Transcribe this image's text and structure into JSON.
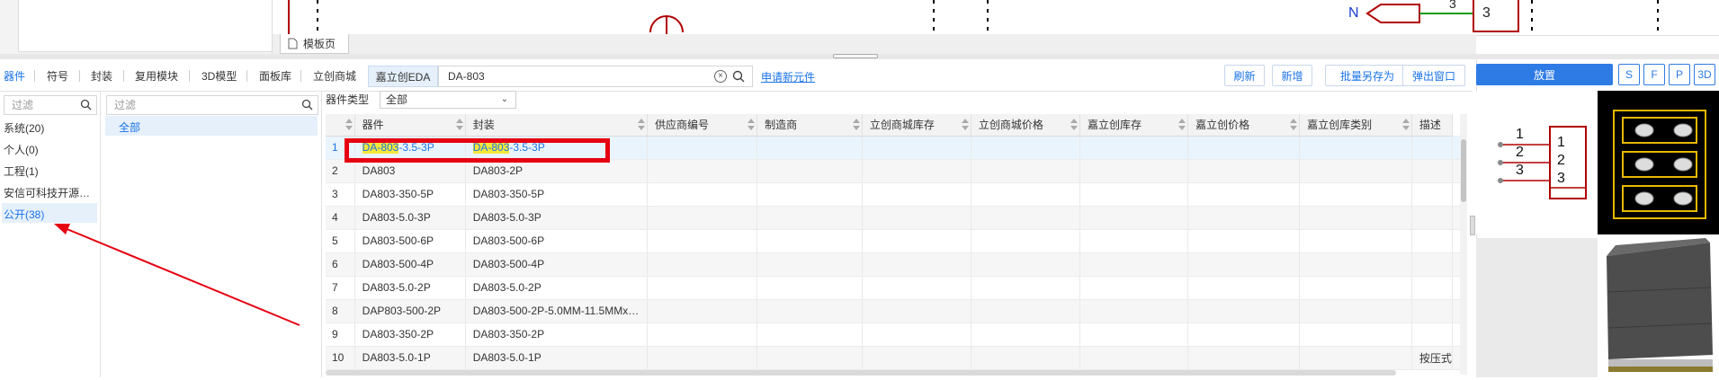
{
  "doc_tab": {
    "label": "模板页"
  },
  "canvas": {
    "net_labels": [
      "N",
      "3",
      "3"
    ]
  },
  "nav": {
    "items": [
      "器件",
      "符号",
      "封装",
      "复用模块",
      "3D模型",
      "面板库",
      "立创商城",
      "嘉立创EDA"
    ],
    "active": "器件"
  },
  "search": {
    "value": "DA-803",
    "apply_link": "申请新元件"
  },
  "buttons": {
    "refresh": "刷新",
    "add": "新增",
    "batch_save": "批量另存为",
    "popup": "弹出窗口"
  },
  "left_panel": {
    "filter_placeholder": "过滤",
    "libraries": [
      "系统(20)",
      "个人(0)",
      "工程(1)",
      "安信可科技开源…",
      "公开(38)"
    ],
    "selected": "公开(38)"
  },
  "mid_panel": {
    "filter_placeholder": "过滤",
    "items": [
      "全部"
    ]
  },
  "type_filter": {
    "label": "器件类型",
    "value": "全部"
  },
  "table": {
    "headers": [
      "器件",
      "封装",
      "供应商编号",
      "制造商",
      "立创商城库存",
      "立创商城价格",
      "嘉立创库存",
      "嘉立创价格",
      "嘉立创库类别",
      "描述"
    ],
    "rows": [
      {
        "idx": "1",
        "part": "DA-803-3.5-3P",
        "pkg": "DA-803-3.5-3P",
        "desc": ""
      },
      {
        "idx": "2",
        "part": "DA803",
        "pkg": "DA803-2P",
        "desc": ""
      },
      {
        "idx": "3",
        "part": "DA803-350-5P",
        "pkg": "DA803-350-5P",
        "desc": ""
      },
      {
        "idx": "4",
        "part": "DA803-5.0-3P",
        "pkg": "DA803-5.0-3P",
        "desc": ""
      },
      {
        "idx": "5",
        "part": "DA803-500-6P",
        "pkg": "DA803-500-6P",
        "desc": ""
      },
      {
        "idx": "6",
        "part": "DA803-500-4P",
        "pkg": "DA803-500-4P",
        "desc": ""
      },
      {
        "idx": "7",
        "part": "DA803-5.0-2P",
        "pkg": "DA803-5.0-2P",
        "desc": ""
      },
      {
        "idx": "8",
        "part": "DAP803-500-2P",
        "pkg": "DA803-500-2P-5.0MM-11.5MMx…",
        "desc": ""
      },
      {
        "idx": "9",
        "part": "DA803-350-2P",
        "pkg": "DA803-350-2P",
        "desc": ""
      },
      {
        "idx": "10",
        "part": "DA803-5.0-1P",
        "pkg": "DA803-5.0-1P",
        "desc": "按压式"
      }
    ],
    "highlight_term": "DA-803"
  },
  "right_panel": {
    "place": "放置",
    "view_buttons": [
      "S",
      "F",
      "P",
      "3D"
    ],
    "symbol_pins": [
      "1",
      "2",
      "3"
    ]
  },
  "colors": {
    "accent": "#1a73e8",
    "annotation": "#e60012",
    "highlight": "#f5e83a"
  }
}
